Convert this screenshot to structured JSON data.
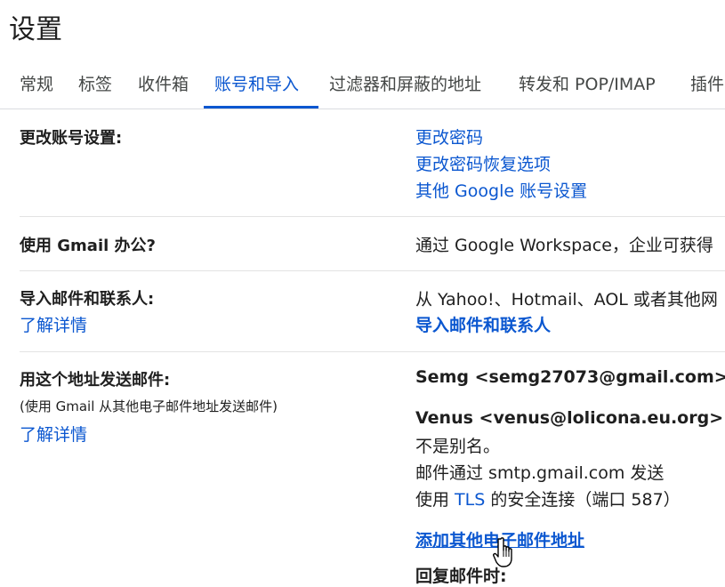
{
  "page": {
    "title": "设置"
  },
  "tabs": [
    {
      "label": "常规"
    },
    {
      "label": "标签"
    },
    {
      "label": "收件箱"
    },
    {
      "label": "账号和导入"
    },
    {
      "label": "过滤器和屏蔽的地址"
    },
    {
      "label": "转发和 POP/IMAP"
    },
    {
      "label": "插件"
    }
  ],
  "sections": {
    "change_account": {
      "label": "更改账号设置:",
      "links": [
        "更改密码",
        "更改密码恢复选项",
        "其他 Google 账号设置"
      ]
    },
    "work": {
      "label": "使用 Gmail 办公?",
      "text": "通过 Google Workspace，企业可获得"
    },
    "import": {
      "label": "导入邮件和联系人:",
      "learn_more": "了解详情",
      "text": "从 Yahoo!、Hotmail、AOL 或者其他网",
      "action": "导入邮件和联系人"
    },
    "send_as": {
      "label": "用这个地址发送邮件:",
      "sub": "(使用 Gmail 从其他电子邮件地址发送邮件)",
      "learn_more": "了解详情",
      "primary": "Semg <semg27073@gmail.com>",
      "secondary": "Venus <venus@lolicona.eu.org>",
      "alias_note": "不是别名。",
      "via_smtp": "邮件通过 smtp.gmail.com 发送",
      "secure_prefix": "使用 ",
      "secure_tls": "TLS",
      "secure_suffix": " 的安全连接（端口 587）",
      "add_address": "添加其他电子邮件地址",
      "next_partial": "回复邮件时:"
    }
  },
  "colors": {
    "accent": "#0b57d0",
    "text": "#1f1f1f",
    "divider": "#e3e3e3"
  }
}
